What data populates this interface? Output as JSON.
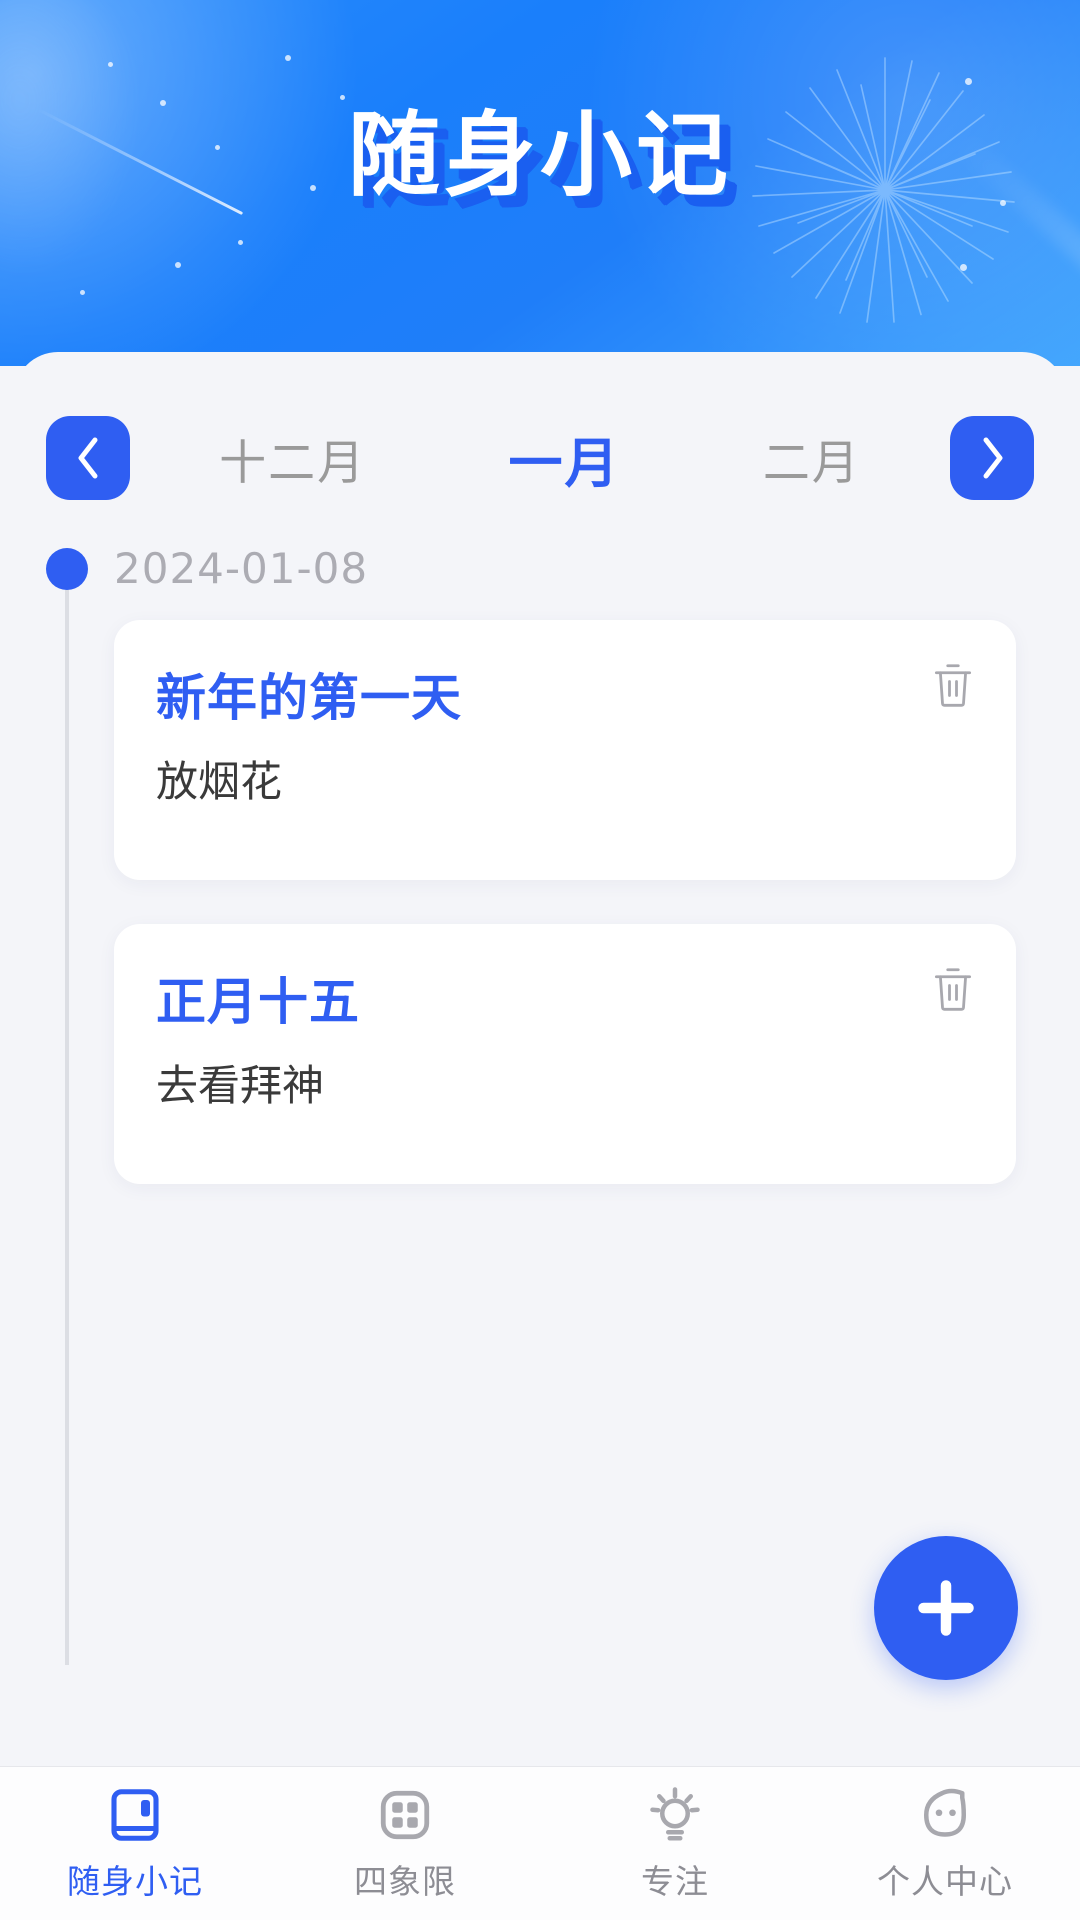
{
  "header": {
    "title": "随身小记",
    "decor_icon": "firework-icon",
    "gradient_from": "#2a8cfb",
    "gradient_to": "#43a6fd"
  },
  "month_bar": {
    "prev_icon": "chevron-left-icon",
    "next_icon": "chevron-right-icon",
    "months": [
      {
        "label": "十二月",
        "active": false
      },
      {
        "label": "一月",
        "active": true
      },
      {
        "label": "二月",
        "active": false
      }
    ],
    "active_color": "#2f5ef2",
    "inactive_color": "#9a9a9a"
  },
  "timeline": {
    "groups": [
      {
        "date": "2024-01-08",
        "notes": [
          {
            "title": "新年的第一天",
            "body": "放烟花",
            "delete_icon": "trash-icon"
          },
          {
            "title": "正月十五",
            "body": "去看拜神",
            "delete_icon": "trash-icon"
          }
        ]
      }
    ]
  },
  "fab": {
    "label": "+",
    "icon": "plus-icon",
    "color": "#2f5ef2"
  },
  "tabbar": {
    "items": [
      {
        "label": "随身小记",
        "icon": "notebook-icon",
        "active": true
      },
      {
        "label": "四象限",
        "icon": "quadrant-grid-icon",
        "active": false
      },
      {
        "label": "专注",
        "icon": "lightbulb-icon",
        "active": false
      },
      {
        "label": "个人中心",
        "icon": "profile-face-icon",
        "active": false
      }
    ],
    "active_color": "#2f5ef2",
    "inactive_color": "#8d8d94"
  }
}
